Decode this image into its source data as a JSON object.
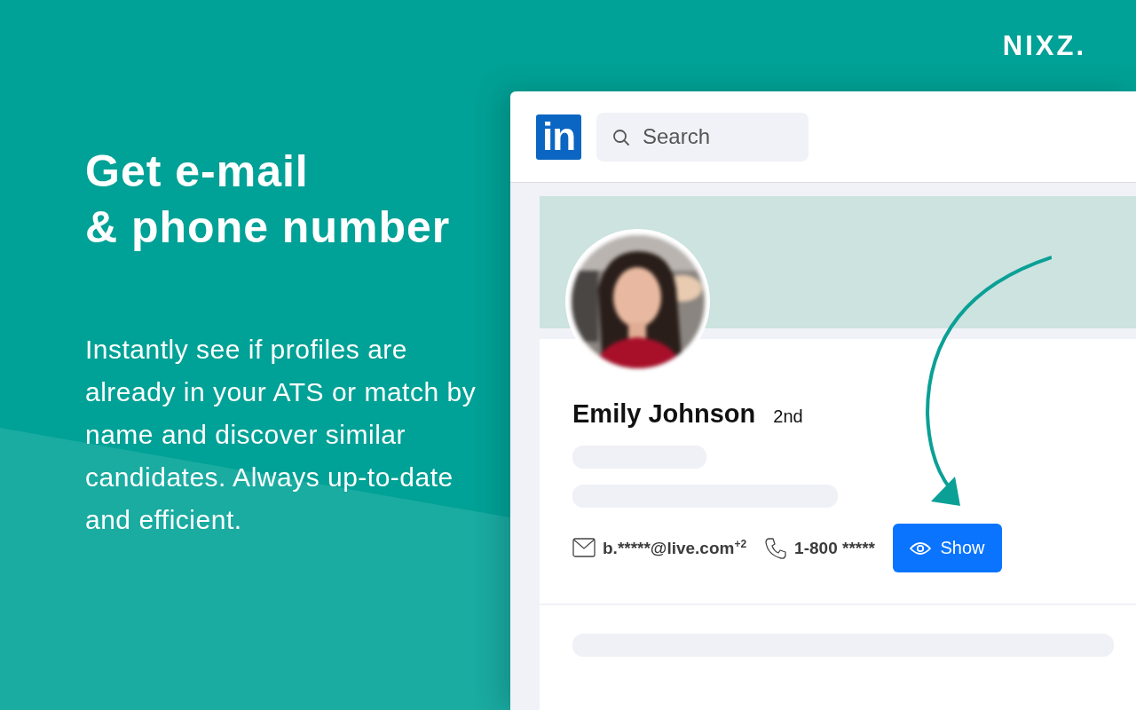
{
  "brand": {
    "logo": "NIXZ."
  },
  "headline": [
    "Get e-mail",
    "& phone number"
  ],
  "description": "Instantly see if profiles are already in your ATS or match by name and discover similar candidates. Always up-to-date and efficient.",
  "mockup": {
    "header": {
      "logo": "in",
      "search": {
        "placeholder": "Search"
      }
    },
    "profile": {
      "name": "Emily Johnson",
      "degree": "2nd",
      "contacts": [
        {
          "kind": "email",
          "text": "b.*****@live.com",
          "superscript": "+2"
        },
        {
          "kind": "phone",
          "text": "1-800 *****"
        }
      ],
      "show_button": "Show"
    }
  }
}
